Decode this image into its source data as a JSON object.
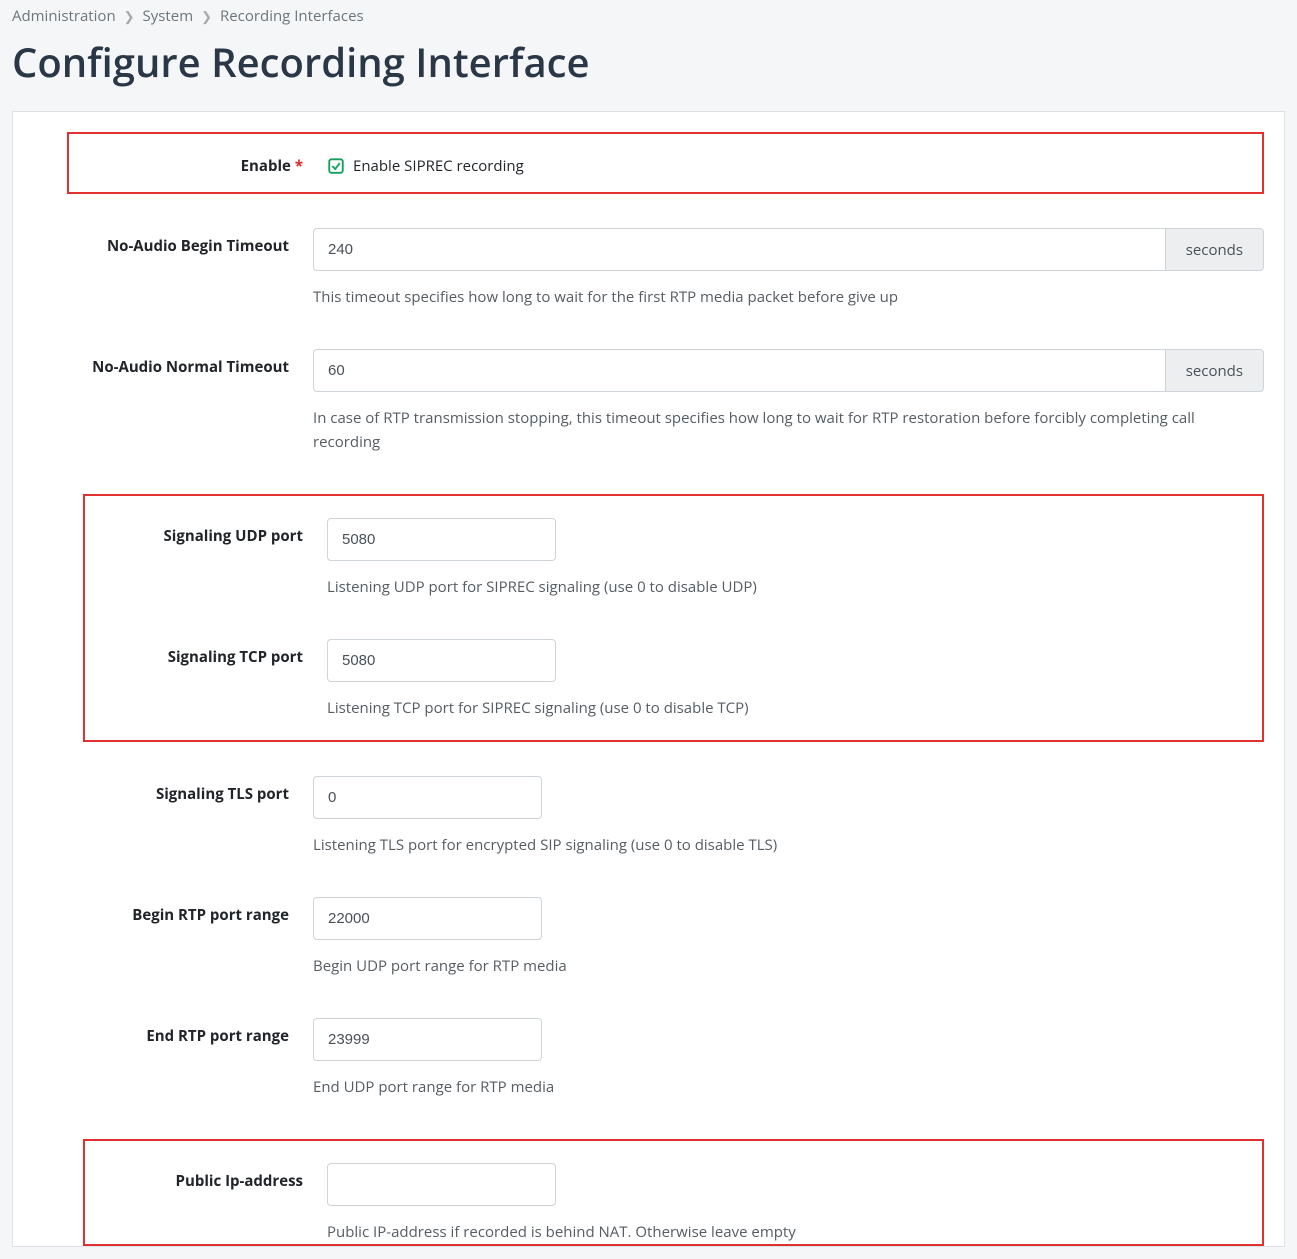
{
  "breadcrumb": {
    "items": [
      "Administration",
      "System",
      "Recording Interfaces"
    ]
  },
  "page": {
    "title": "Configure Recording Interface"
  },
  "fields": {
    "enable": {
      "label": "Enable",
      "required_marker": "*",
      "checkbox_label": "Enable SIPREC recording",
      "checked": true
    },
    "no_audio_begin_timeout": {
      "label": "No-Audio Begin Timeout",
      "value": "240",
      "unit": "seconds",
      "help": "This timeout specifies how long to wait for the first RTP media packet before give up"
    },
    "no_audio_normal_timeout": {
      "label": "No-Audio Normal Timeout",
      "value": "60",
      "unit": "seconds",
      "help": "In case of RTP transmission stopping, this timeout specifies how long to wait for RTP restoration before forcibly completing call recording"
    },
    "signaling_udp_port": {
      "label": "Signaling UDP port",
      "value": "5080",
      "help": "Listening UDP port for SIPREC signaling (use 0 to disable UDP)"
    },
    "signaling_tcp_port": {
      "label": "Signaling TCP port",
      "value": "5080",
      "help": "Listening TCP port for SIPREC signaling (use 0 to disable TCP)"
    },
    "signaling_tls_port": {
      "label": "Signaling TLS port",
      "value": "0",
      "help": "Listening TLS port for encrypted SIP signaling (use 0 to disable TLS)"
    },
    "begin_rtp_port_range": {
      "label": "Begin RTP port range",
      "value": "22000",
      "help": "Begin UDP port range for RTP media"
    },
    "end_rtp_port_range": {
      "label": "End RTP port range",
      "value": "23999",
      "help": "End UDP port range for RTP media"
    },
    "public_ip_address": {
      "label": "Public Ip-address",
      "value": "",
      "help": "Public IP-address if recorded is behind NAT. Otherwise leave empty"
    }
  }
}
